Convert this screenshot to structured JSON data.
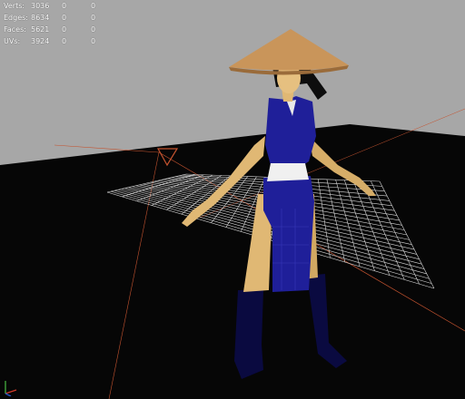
{
  "hud": {
    "rows": [
      {
        "label": "Verts:",
        "value": "3036",
        "tri": "0",
        "sel": "0"
      },
      {
        "label": "Edges:",
        "value": "8634",
        "tri": "0",
        "sel": "0"
      },
      {
        "label": "Faces:",
        "value": "5621",
        "tri": "0",
        "sel": "0"
      },
      {
        "label": "UVs:",
        "value": "3924",
        "tri": "0",
        "sel": "0"
      }
    ]
  },
  "colors": {
    "background": "#a7a7a7",
    "ground": "#060606",
    "grid": "#d9d9d9",
    "outfit": "#1f1f99",
    "skin": "#e0b874",
    "hat": "#c9955a",
    "hair": "#0d0d0d",
    "axis_x": "#d23a2a",
    "axis_y": "#3fa33a",
    "axis_z": "#2a55c8"
  },
  "scene": {
    "model": "character-model",
    "hat": "straw-hat",
    "axis": "axis-gizmo-icon"
  }
}
